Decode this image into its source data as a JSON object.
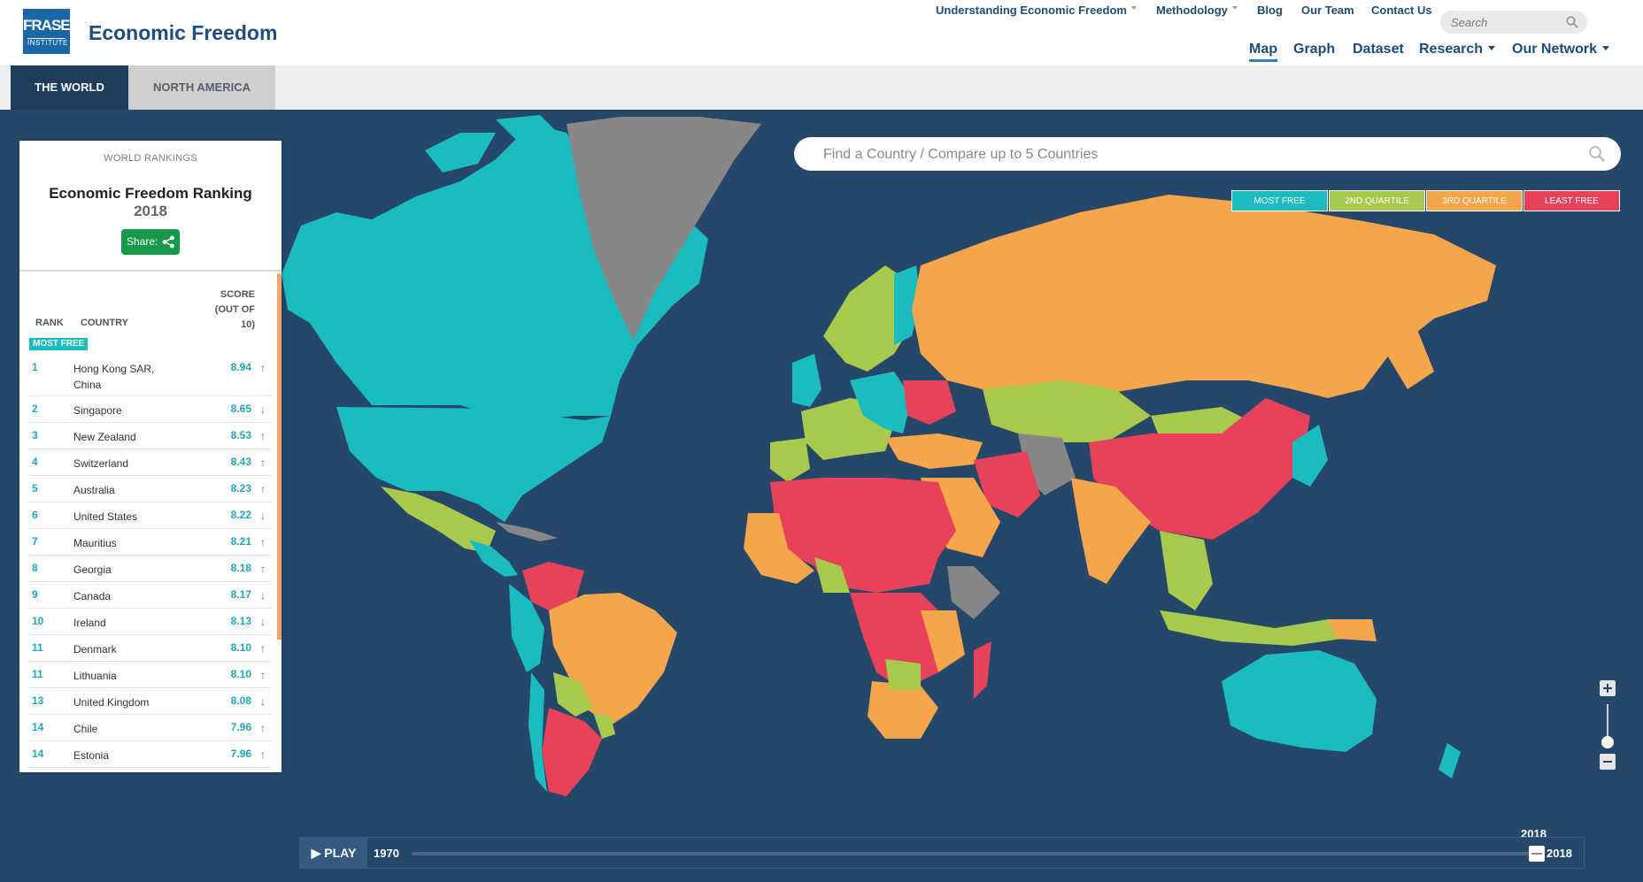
{
  "header": {
    "logo_top": "FRASER",
    "logo_bottom": "INSTITUTE",
    "site_title": "Economic Freedom",
    "top_nav": [
      {
        "label": "Understanding Economic Freedom",
        "dropdown": true
      },
      {
        "label": "Methodology",
        "dropdown": true
      },
      {
        "label": "Blog",
        "dropdown": false
      },
      {
        "label": "Our Team",
        "dropdown": false
      },
      {
        "label": "Contact Us",
        "dropdown": false
      }
    ],
    "search_placeholder": "Search",
    "main_nav": [
      {
        "label": "Map",
        "active": true,
        "dropdown": false
      },
      {
        "label": "Graph",
        "active": false,
        "dropdown": false
      },
      {
        "label": "Dataset",
        "active": false,
        "dropdown": false
      },
      {
        "label": "Research",
        "active": false,
        "dropdown": true
      },
      {
        "label": "Our Network",
        "active": false,
        "dropdown": true
      }
    ]
  },
  "tabs": [
    {
      "label": "THE WORLD",
      "active": true
    },
    {
      "label": "NORTH AMERICA",
      "active": false
    }
  ],
  "rankings": {
    "kicker": "WORLD RANKINGS",
    "title": "Economic Freedom Ranking",
    "year": "2018",
    "share_label": "Share:",
    "col_rank": "RANK",
    "col_country": "COUNTRY",
    "col_score_lines": [
      "SCORE",
      "(OUT OF",
      "10)"
    ],
    "group_label": "MOST FREE",
    "rows": [
      {
        "rank": "1",
        "country": "Hong Kong SAR, China",
        "score": "8.94",
        "trend": "up"
      },
      {
        "rank": "2",
        "country": "Singapore",
        "score": "8.65",
        "trend": "down"
      },
      {
        "rank": "3",
        "country": "New Zealand",
        "score": "8.53",
        "trend": "up"
      },
      {
        "rank": "4",
        "country": "Switzerland",
        "score": "8.43",
        "trend": "up"
      },
      {
        "rank": "5",
        "country": "Australia",
        "score": "8.23",
        "trend": "up"
      },
      {
        "rank": "6",
        "country": "United States",
        "score": "8.22",
        "trend": "down"
      },
      {
        "rank": "7",
        "country": "Mauritius",
        "score": "8.21",
        "trend": "up"
      },
      {
        "rank": "8",
        "country": "Georgia",
        "score": "8.18",
        "trend": "up"
      },
      {
        "rank": "9",
        "country": "Canada",
        "score": "8.17",
        "trend": "down"
      },
      {
        "rank": "10",
        "country": "Ireland",
        "score": "8.13",
        "trend": "down"
      },
      {
        "rank": "11",
        "country": "Denmark",
        "score": "8.10",
        "trend": "up"
      },
      {
        "rank": "11",
        "country": "Lithuania",
        "score": "8.10",
        "trend": "up"
      },
      {
        "rank": "13",
        "country": "United Kingdom",
        "score": "8.08",
        "trend": "down"
      },
      {
        "rank": "14",
        "country": "Chile",
        "score": "7.96",
        "trend": "up"
      },
      {
        "rank": "14",
        "country": "Estonia",
        "score": "7.96",
        "trend": "up"
      }
    ]
  },
  "map": {
    "search_placeholder": "Find a Country / Compare up to 5 Countries",
    "ocean_color": "#25476a",
    "no_data_color": "#878787",
    "legend": [
      {
        "label": "MOST FREE",
        "color": "#1bbcc0"
      },
      {
        "label": "2ND QUARTILE",
        "color": "#a8c94c"
      },
      {
        "label": "3RD QUARTILE",
        "color": "#f5a54a"
      },
      {
        "label": "LEAST FREE",
        "color": "#e8425b"
      }
    ]
  },
  "timeline": {
    "play_label": "PLAY",
    "start_year": "1970",
    "end_year": "2018",
    "current_year": "2018"
  }
}
